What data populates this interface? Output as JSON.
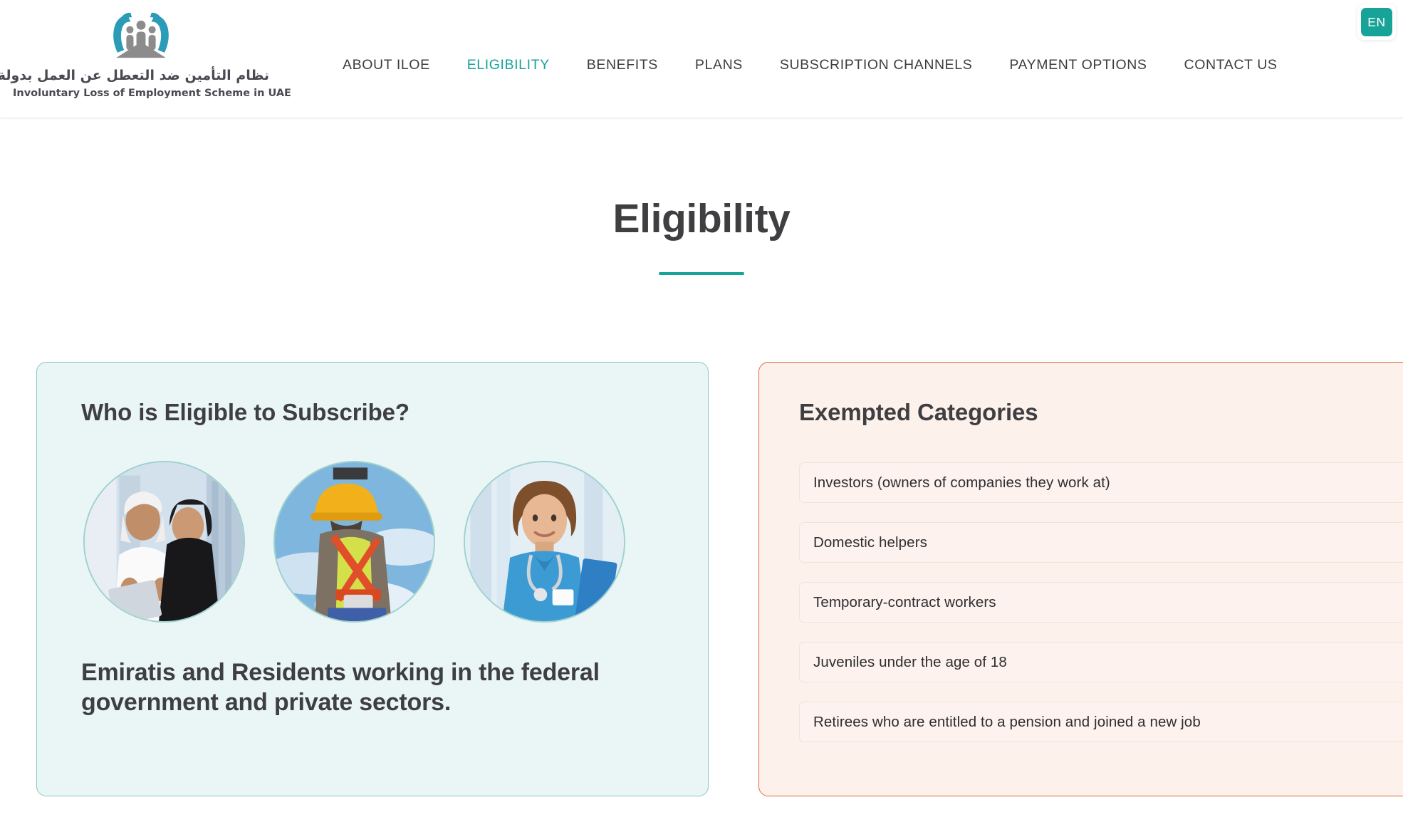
{
  "header": {
    "logo_icon": "hands-protecting-people-logo",
    "brand_arabic": "نظام التأمين ضد التعطل عن العمل بدولة الإمارات",
    "brand_english": "Involuntary Loss of Employment Scheme in UAE",
    "nav": [
      {
        "label": "ABOUT ILOE",
        "active": false
      },
      {
        "label": "ELIGIBILITY",
        "active": true
      },
      {
        "label": "BENEFITS",
        "active": false
      },
      {
        "label": "PLANS",
        "active": false
      },
      {
        "label": "SUBSCRIPTION CHANNELS",
        "active": false
      },
      {
        "label": "PAYMENT OPTIONS",
        "active": false
      },
      {
        "label": "CONTACT US",
        "active": false
      }
    ],
    "language": {
      "current": "EN",
      "icon": "language-switch-icon"
    }
  },
  "page": {
    "title": "Eligibility"
  },
  "eligible_card": {
    "title": "Who is Eligible to Subscribe?",
    "statement": "Emiratis and Residents working in the federal government and private sectors.",
    "photos": [
      {
        "alt": "emirati-business-couple-with-tablet"
      },
      {
        "alt": "construction-worker-with-safety-harness"
      },
      {
        "alt": "healthcare-nurse-with-clipboard"
      }
    ]
  },
  "exempt_card": {
    "title": "Exempted Categories",
    "items": [
      "Investors (owners of companies they work at)",
      "Domestic helpers",
      "Temporary-contract workers",
      "Juveniles under the age of 18",
      "Retirees who are entitled to a pension and joined a new job"
    ]
  },
  "colors": {
    "accent_teal": "#16a398",
    "eligible_border": "#86c9c4",
    "eligible_bg": "#eaf6f5",
    "exempt_border": "#e06a3b",
    "exempt_bg": "#fdf1ec",
    "text_dark": "#3f3f42"
  }
}
